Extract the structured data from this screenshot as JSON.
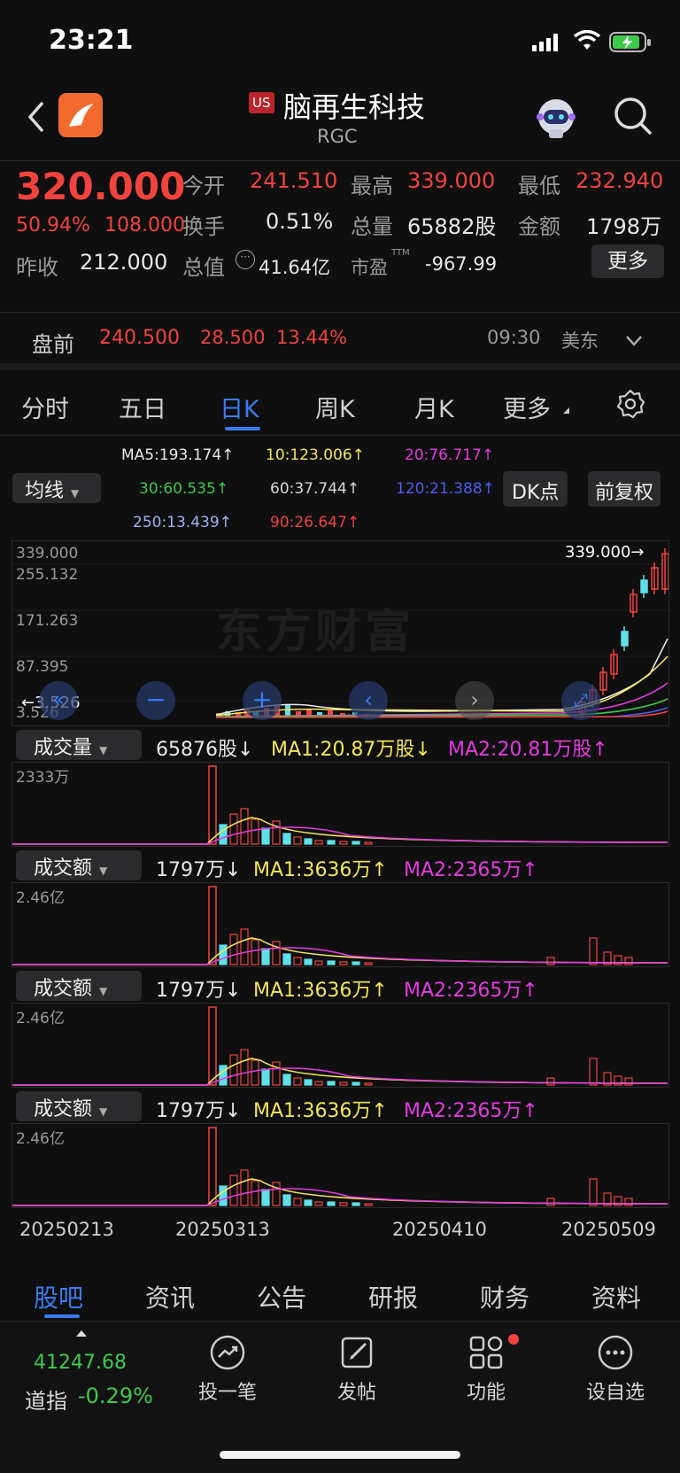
{
  "status": {
    "time": "23:21"
  },
  "header": {
    "market_badge": "US",
    "name": "脑再生科技",
    "code": "RGC"
  },
  "quote": {
    "price": "320.000",
    "change_pct": "50.94%",
    "change": "108.000",
    "open_label": "今开",
    "open": "241.510",
    "high_label": "最高",
    "high": "339.000",
    "low_label": "最低",
    "low": "232.940",
    "turnover_label": "换手",
    "turnover": "0.51%",
    "volume_label": "总量",
    "volume": "65882股",
    "amount_label": "金额",
    "amount": "1798万",
    "prev_close_label": "昨收",
    "prev_close": "212.000",
    "mktcap_label": "总值",
    "mktcap": "41.64亿",
    "pe_label": "市盈",
    "pe_sup": "TTM",
    "pe": "-967.99",
    "more_label": "更多"
  },
  "premarket": {
    "label": "盘前",
    "price": "240.500",
    "change": "28.500",
    "pct": "13.44%",
    "time": "09:30",
    "zone": "美东"
  },
  "tabs": [
    "分时",
    "五日",
    "日K",
    "周K",
    "月K",
    "更多"
  ],
  "ma_legend": {
    "ma5": "MA5:193.174↑",
    "ma10": "10:123.006↑",
    "ma20": "20:76.717↑",
    "ma30": "30:60.535↑",
    "ma60": "60:37.744↑",
    "ma120": "120:21.388↑",
    "ma250": "250:13.439↑",
    "ma90": "90:26.647↑",
    "selector": "均线",
    "dk_button": "DK点",
    "adjust_button": "前复权"
  },
  "colors": {
    "up": "#f0433e",
    "down": "#3ec94b",
    "cyan": "#5fe0e8",
    "ma1": "#f4e55a",
    "ma2": "#e43be0",
    "accent": "#3a7cf0"
  },
  "price_chart": {
    "y_ticks": [
      "339.000",
      "255.132",
      "171.263",
      "87.395",
      "3.526"
    ],
    "high_marker": "339.000→",
    "low_marker": "←3.526",
    "watermark": "东方财富"
  },
  "volume_panel": {
    "selector": "成交量",
    "value": "65876股↓",
    "ma1": "MA1:20.87万股↓",
    "ma2": "MA2:20.81万股↑",
    "ymax": "2333万"
  },
  "amount_panels": [
    {
      "selector": "成交额",
      "value": "1797万↓",
      "ma1": "MA1:3636万↑",
      "ma2": "MA2:2365万↑",
      "ymax": "2.46亿"
    },
    {
      "selector": "成交额",
      "value": "1797万↓",
      "ma1": "MA1:3636万↑",
      "ma2": "MA2:2365万↑",
      "ymax": "2.46亿"
    },
    {
      "selector": "成交额",
      "value": "1797万↓",
      "ma1": "MA1:3636万↑",
      "ma2": "MA2:2365万↑",
      "ymax": "2.46亿"
    }
  ],
  "x_dates": [
    "20250213",
    "20250313",
    "20250410",
    "20250509"
  ],
  "bottom_tabs": [
    "股吧",
    "资讯",
    "公告",
    "研报",
    "财务",
    "资料"
  ],
  "toolbar": {
    "index_value": "41247.68",
    "index_name": "道指",
    "index_change": "-0.29%",
    "invest": "投一笔",
    "post": "发帖",
    "functions": "功能",
    "watchlist": "设自选"
  }
}
